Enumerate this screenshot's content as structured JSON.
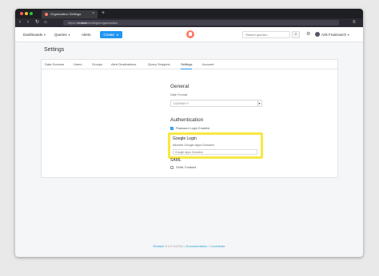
{
  "browser": {
    "tab_title": "Organization Settings",
    "tab_close": "×",
    "new_tab": "+",
    "url_prefix": "https://",
    "url_host": "redash",
    "url_path": "/settings/organization",
    "back": "‹",
    "forward": "›",
    "reload": "↻",
    "home": "⌂",
    "menu": "≡"
  },
  "header": {
    "nav": [
      "Dashboards",
      "Queries",
      "Alerts"
    ],
    "create_label": "Create",
    "search_placeholder": "Search queries...",
    "search_icon": "⌕",
    "settings_icon": "⚙",
    "user_name": "Arik Fraimovich"
  },
  "page": {
    "title": "Settings",
    "tabs": [
      "Data Sources",
      "Users",
      "Groups",
      "Alert Destinations",
      "Query Snippets",
      "Settings",
      "Account"
    ],
    "active_tab": "Settings"
  },
  "general": {
    "heading": "General",
    "date_format_label": "Date Format",
    "date_format_value": "DD/MM/YY"
  },
  "authentication": {
    "heading": "Authentication",
    "password_login_label": "Password Login Enabled",
    "password_login_enabled": true,
    "google_login_heading": "Google Login",
    "google_domains_label": "Allowed Google Apps Domains",
    "google_domains_placeholder": "Google Apps Domains",
    "saml_heading": "SAML",
    "saml_label": "SAML Enabled",
    "saml_enabled": false
  },
  "footer": {
    "brand": "Redash",
    "version": "5.0.2+b4754",
    "separator": "•",
    "documentation": "Documentation",
    "contribute": "Contribute"
  },
  "colors": {
    "accent": "#2196f3",
    "brand": "#ff7964",
    "highlight": "#f7e843"
  }
}
